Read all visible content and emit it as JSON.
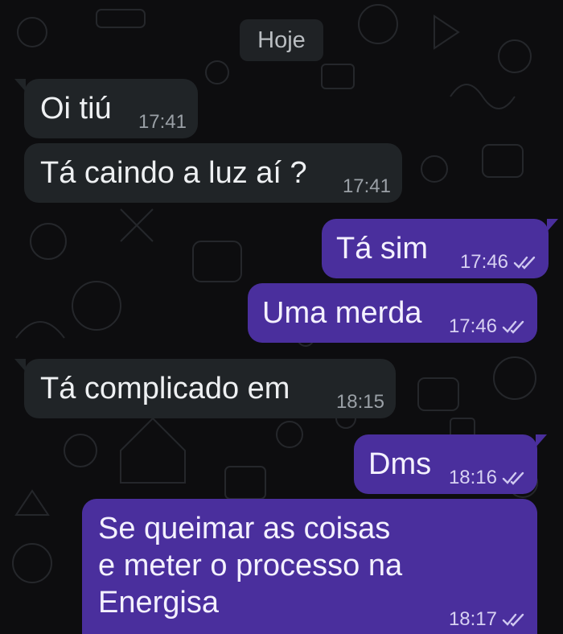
{
  "date_divider": "Hoje",
  "messages": [
    {
      "direction": "in",
      "text": "Oi tiú",
      "time": "17:41"
    },
    {
      "direction": "in",
      "text": "Tá caindo a luz aí ?",
      "time": "17:41"
    },
    {
      "direction": "out",
      "text": "Tá sim",
      "time": "17:46"
    },
    {
      "direction": "out",
      "text": "Uma merda",
      "time": "17:46"
    },
    {
      "direction": "in",
      "text": "Tá complicado em",
      "time": "18:15"
    },
    {
      "direction": "out",
      "text": "Dms",
      "time": "18:16"
    },
    {
      "direction": "out",
      "lines": [
        "Se queimar as coisas",
        "e meter o processo na",
        "Energisa"
      ],
      "time": "18:17"
    }
  ],
  "colors": {
    "background": "#0d0d0f",
    "incoming_bubble": "#202427",
    "outgoing_bubble": "#4a2f9d",
    "read_ticks": "#cfc8f0"
  },
  "icons": {
    "read_receipt": "double-check-icon"
  }
}
